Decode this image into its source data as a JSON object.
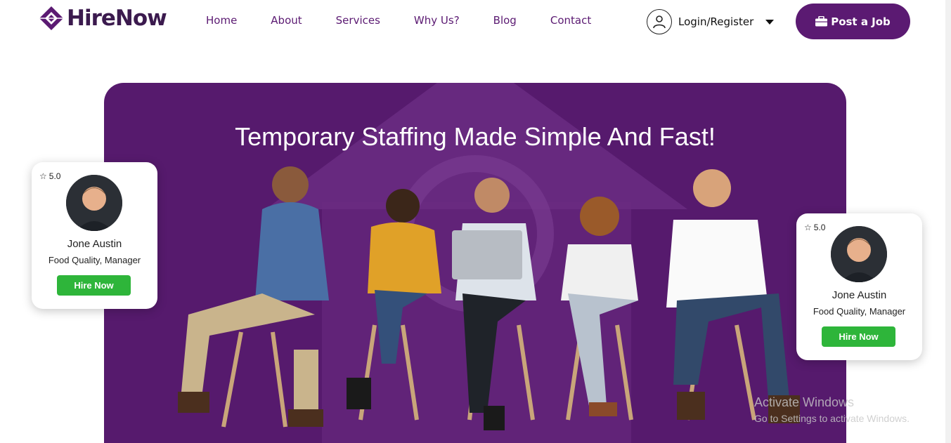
{
  "brand": {
    "name": "HireNow",
    "color": "#5b1a72"
  },
  "nav": [
    {
      "label": "Home"
    },
    {
      "label": "About"
    },
    {
      "label": "Services"
    },
    {
      "label": "Why Us?"
    },
    {
      "label": "Blog"
    },
    {
      "label": "Contact"
    }
  ],
  "account": {
    "label": "Login/Register",
    "icon": "user-circle-icon"
  },
  "cta": {
    "label": "Post a Job",
    "icon": "briefcase-icon"
  },
  "hero": {
    "title": "Temporary Staffing Made Simple And Fast!",
    "bg_color": "#561a6d"
  },
  "cards": [
    {
      "rating": "5.0",
      "name": "Jone Austin",
      "role": "Food Quality, Manager",
      "button": "Hire Now"
    },
    {
      "rating": "5.0",
      "name": "Jone Austin",
      "role": "Food Quality, Manager",
      "button": "Hire Now"
    }
  ],
  "watermark": {
    "title": "Activate Windows",
    "subtitle": "Go to Settings to activate Windows."
  },
  "colors": {
    "accent": "#5b1a72",
    "hire_button": "#2eb53a"
  }
}
